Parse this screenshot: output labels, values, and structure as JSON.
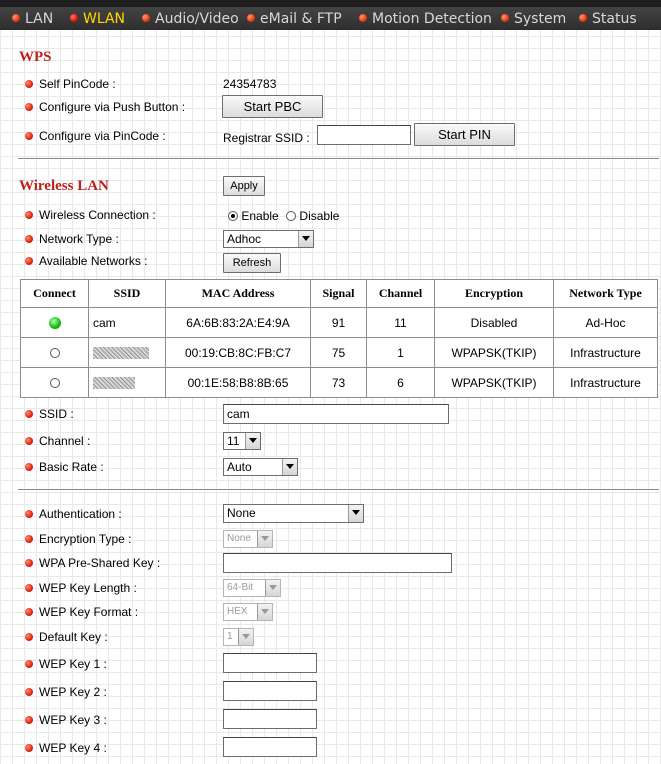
{
  "nav": {
    "items": [
      "LAN",
      "WLAN",
      "Audio/Video",
      "eMail & FTP",
      "Motion Detection",
      "System",
      "Status"
    ],
    "active": "WLAN"
  },
  "wps": {
    "title": "WPS",
    "self_pincode_label": "Self PinCode :",
    "self_pincode_value": "24354783",
    "push_button_label": "Configure via Push Button :",
    "push_button_btn": "Start PBC",
    "pincode_label": "Configure via PinCode :",
    "registrar_ssid_label": "Registrar SSID :",
    "registrar_ssid_value": "",
    "start_pin_btn": "Start PIN"
  },
  "wireless": {
    "title": "Wireless LAN",
    "apply_btn": "Apply",
    "connection_label": "Wireless Connection :",
    "enable_label": "Enable",
    "disable_label": "Disable",
    "connection_value": "Enable",
    "network_type_label": "Network Type :",
    "network_type_value": "Adhoc",
    "available_label": "Available Networks :",
    "refresh_btn": "Refresh",
    "table": {
      "headers": [
        "Connect",
        "SSID",
        "MAC Address",
        "Signal",
        "Channel",
        "Encryption",
        "Network Type"
      ],
      "rows": [
        {
          "connected": true,
          "ssid": "cam",
          "mac": "6A:6B:83:2A:E4:9A",
          "signal": "91",
          "channel": "11",
          "encryption": "Disabled",
          "type": "Ad-Hoc"
        },
        {
          "connected": false,
          "ssid": "",
          "mac": "00:19:CB:8C:FB:C7",
          "signal": "75",
          "channel": "1",
          "encryption": "WPAPSK(TKIP)",
          "type": "Infrastructure"
        },
        {
          "connected": false,
          "ssid": "",
          "mac": "00:1E:58:B8:8B:65",
          "signal": "73",
          "channel": "6",
          "encryption": "WPAPSK(TKIP)",
          "type": "Infrastructure"
        }
      ]
    },
    "ssid_label": "SSID :",
    "ssid_value": "cam",
    "channel_label": "Channel :",
    "channel_value": "11",
    "basic_rate_label": "Basic Rate :",
    "basic_rate_value": "Auto"
  },
  "security": {
    "auth_label": "Authentication :",
    "auth_value": "None",
    "enc_type_label": "Encryption Type :",
    "enc_type_value": "None",
    "wpa_key_label": "WPA Pre-Shared Key :",
    "wpa_key_value": "",
    "wep_len_label": "WEP Key Length :",
    "wep_len_value": "64-Bit",
    "wep_format_label": "WEP Key Format :",
    "wep_format_value": "HEX",
    "default_key_label": "Default Key :",
    "default_key_value": "1",
    "wep_key1_label": "WEP Key 1 :",
    "wep_key2_label": "WEP Key 2 :",
    "wep_key3_label": "WEP Key 3 :",
    "wep_key4_label": "WEP Key 4 :"
  },
  "colors": {
    "section_title": "#c0201a",
    "nav_active": "#ffd800",
    "nav_bg": "#3a3a3a",
    "connected_dot": "#14c114"
  }
}
